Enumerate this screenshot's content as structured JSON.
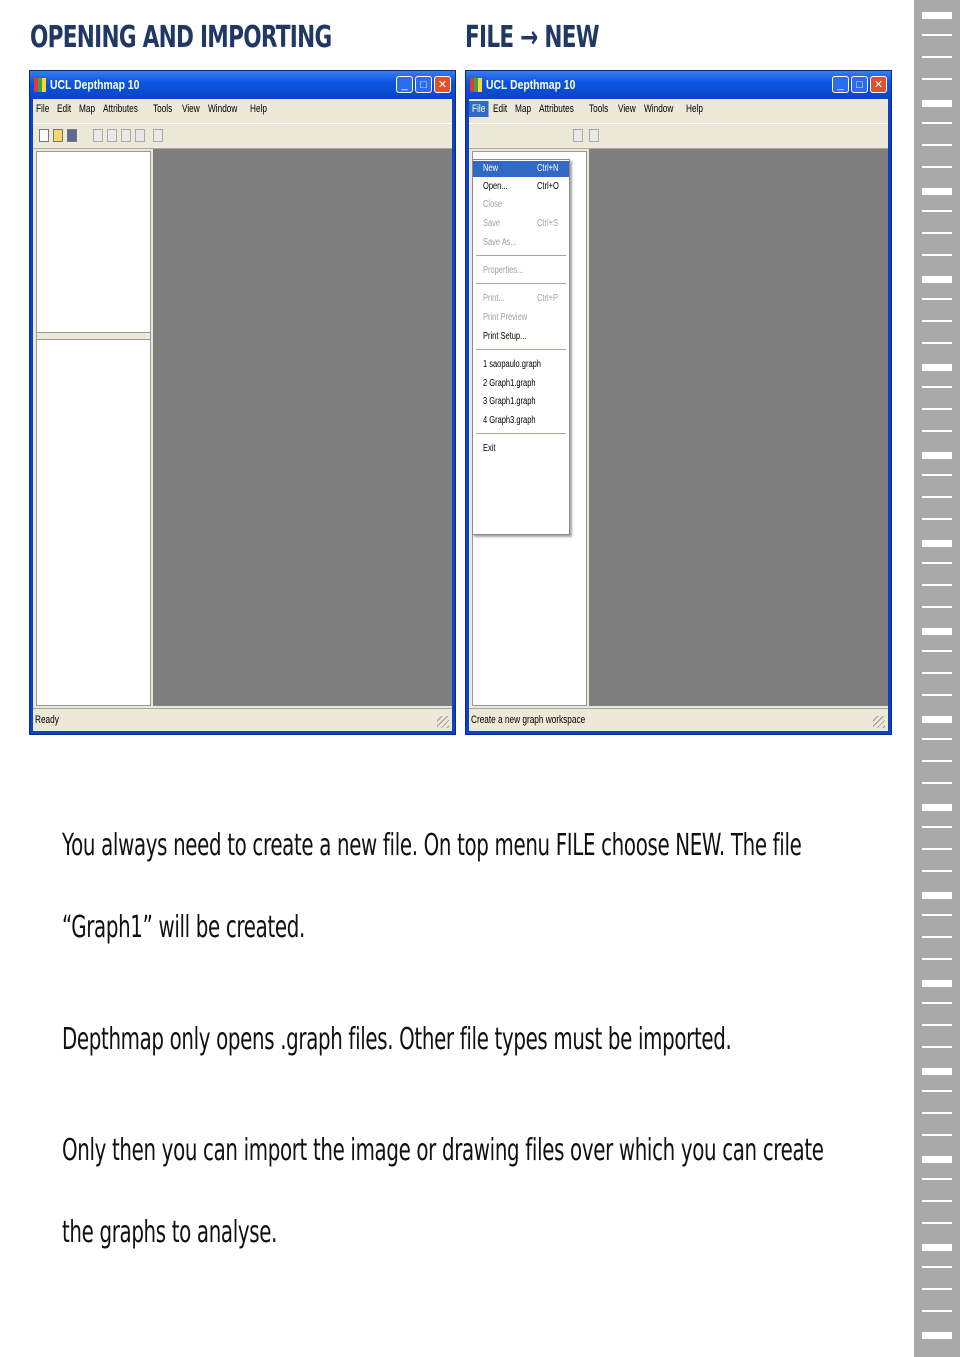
{
  "headings": {
    "left": "OPENING AND IMPORTING",
    "right": "FILE → NEW"
  },
  "windows": {
    "left": {
      "title": "UCL Depthmap 10",
      "status": "Ready"
    },
    "right": {
      "title": "UCL Depthmap 10",
      "status": "Create a new graph workspace"
    }
  },
  "menu": [
    "File",
    "Edit",
    "Map",
    "Attributes",
    "Tools",
    "View",
    "Window",
    "Help"
  ],
  "file_menu": {
    "new": {
      "label": "New",
      "shortcut": "Ctrl+N"
    },
    "open": {
      "label": "Open...",
      "shortcut": "Ctrl+O"
    },
    "close": {
      "label": "Close"
    },
    "save": {
      "label": "Save",
      "shortcut": "Ctrl+S"
    },
    "save_as": {
      "label": "Save As..."
    },
    "properties": {
      "label": "Properties..."
    },
    "print": {
      "label": "Print...",
      "shortcut": "Ctrl+P"
    },
    "print_preview": {
      "label": "Print Preview"
    },
    "print_setup": {
      "label": "Print Setup..."
    },
    "recent1": {
      "label": "1 saopaulo.graph"
    },
    "recent2": {
      "label": "2 Graph1.graph"
    },
    "recent3": {
      "label": "3 Graph1.graph"
    },
    "recent4": {
      "label": "4 Graph3.graph"
    },
    "exit": {
      "label": "Exit"
    }
  },
  "text": {
    "p1_line1": "You always need to create  a new file. On top menu FILE choose NEW. The file",
    "p1_line2": "“Graph1” will be created.",
    "p2": "Depthmap only opens .graph files. Other file types must be imported.",
    "p3_line1": "Only then you can import the image or drawing files over which you can create",
    "p3_line2": "the graphs to analyse."
  },
  "colors": {
    "heading": "#1f3864",
    "titlebar": "#0a55e0",
    "workspace": "#7f7f7f",
    "highlight": "#316ac5"
  }
}
